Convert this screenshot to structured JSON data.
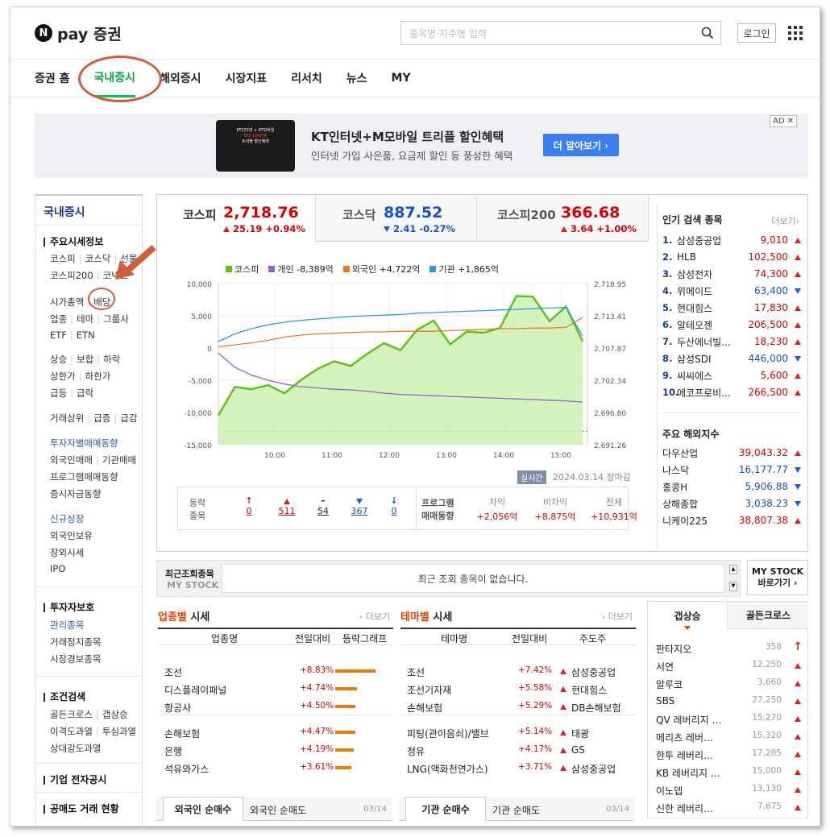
{
  "brand": {
    "logo_n": "N",
    "logo_text": "pay 증권"
  },
  "search": {
    "placeholder": "종목명·지수명 입력"
  },
  "header": {
    "login": "로그인"
  },
  "nav": [
    "증권 홈",
    "국내증시",
    "해외증시",
    "시장지표",
    "리서치",
    "뉴스",
    "MY"
  ],
  "ad": {
    "img_line1": "KT인터넷 + KT모바일",
    "img_line2": "최대 106만원",
    "img_line3": "트리플 할인혜택",
    "title": "KT인터넷+M모바일 트리플 할인혜택",
    "sub": "인터넷 가입 사은품, 요금제 할인 등 풍성한 혜택",
    "button": "더 알아보기 ›",
    "tag": "AD ✕"
  },
  "sidebar": {
    "title": "국내증시",
    "s1": "주요시세정보",
    "l1a": "코스피",
    "l1b": "코스닥",
    "l1c": "선물",
    "l2a": "코스피200",
    "l2b": "코넥스",
    "l3a": "시가총액",
    "l3b": "배당",
    "l4a": "업종",
    "l4b": "테마",
    "l4c": "그룹사",
    "l5a": "ETF",
    "l5b": "ETN",
    "l6a": "상승",
    "l6b": "보합",
    "l6c": "하락",
    "l7a": "상한가",
    "l7b": "하한가",
    "l8a": "급등",
    "l8b": "급락",
    "l9a": "거래상위",
    "l9b": "급증",
    "l9c": "급감",
    "l10": "투자자별매매동향",
    "l11a": "외국인매매",
    "l11b": "기관매매",
    "l12": "프로그램매매동향",
    "l13": "증시자금동향",
    "l14": "신규상장",
    "l15": "외국인보유",
    "l16": "장외시세",
    "l17": "IPO",
    "s2": "투자자보호",
    "l18": "관리종목",
    "l19": "거래정지종목",
    "l20": "시장경보종목",
    "s3": "조건검색",
    "l21a": "골든크로스",
    "l21b": "갭상승",
    "l22a": "이격도과열",
    "l22b": "투심과열",
    "l23": "상대강도과열",
    "s4": "기업 전자공시",
    "s5": "공매도 거래 현황"
  },
  "index_tabs": [
    {
      "name": "코스피",
      "value": "2,718.76",
      "change": "25.19 +0.94%",
      "dir": "up"
    },
    {
      "name": "코스닥",
      "value": "887.52",
      "change": "2.41 -0.27%",
      "dir": "down"
    },
    {
      "name": "코스피200",
      "value": "366.68",
      "change": "3.64 +1.00%",
      "dir": "up"
    }
  ],
  "chart_data": {
    "type": "line",
    "legend": [
      "코스피",
      "개인 -8,389억",
      "외국인 +4,722억",
      "기관 +1,865억"
    ],
    "x_ticks": [
      "10:00",
      "11:00",
      "12:00",
      "13:00",
      "14:00",
      "15:00"
    ],
    "y_left_ticks": [
      "10,000",
      "5,000",
      "0",
      "-5,000",
      "-10,000",
      "-15,000"
    ],
    "y_right_ticks": [
      "2,718.95",
      "2,713.41",
      "2,707.87",
      "2,702.34",
      "2,696.80",
      "2,691.26"
    ],
    "ylim_left": [
      -15000,
      10000
    ],
    "ylim_right": [
      2691.26,
      2718.95
    ],
    "series": [
      {
        "name": "코스피",
        "color": "#5ac41a",
        "values": [
          2696.3,
          2701.2,
          2700.8,
          2701.5,
          2700.1,
          2702.4,
          2704.3,
          2705.6,
          2704.8,
          2706.9,
          2708.7,
          2707.5,
          2711.0,
          2712.6,
          2708.5,
          2710.7,
          2710.5,
          2711.3,
          2716.8,
          2716.7,
          2712.5,
          2715.0,
          2709.0
        ]
      },
      {
        "name": "개인",
        "color": "#9a5fd0",
        "values": [
          -800,
          -3000,
          -4200,
          -5000,
          -5600,
          -6000,
          -6200,
          -6400,
          -6500,
          -6700,
          -7000,
          -7200,
          -7300,
          -7400,
          -7500,
          -7600,
          -7700,
          -7800,
          -7900,
          -8000,
          -8100,
          -8200,
          -8389
        ]
      },
      {
        "name": "외국인",
        "color": "#f07a1a",
        "values": [
          200,
          500,
          800,
          1200,
          1700,
          2000,
          2200,
          2300,
          2400,
          2500,
          2500,
          2600,
          2600,
          2600,
          2700,
          2800,
          2900,
          3000,
          3000,
          3100,
          3100,
          3200,
          4722
        ]
      },
      {
        "name": "기관",
        "color": "#2b9be8",
        "values": [
          1000,
          2200,
          3000,
          3600,
          4000,
          4300,
          4500,
          4700,
          4900,
          5000,
          5100,
          5200,
          5400,
          5500,
          5600,
          5700,
          5800,
          5900,
          6000,
          6100,
          6200,
          6300,
          1865
        ]
      }
    ]
  },
  "realtime": {
    "badge": "실시간",
    "date": "2024.03.14",
    "status": "장마감"
  },
  "trade": {
    "l1": "등락",
    "l2": "종목",
    "v1": "0",
    "v2": "511",
    "v3": "54",
    "v4": "367",
    "v5": "0",
    "p1": "프로그램",
    "p2": "매매동향",
    "h1": "차익",
    "h2": "비차익",
    "h3": "전체",
    "n1": "+2,056억",
    "n2": "+8,875억",
    "n3": "+10,931억"
  },
  "popular": {
    "title": "인기 검색 종목",
    "more": "더보기›",
    "items": [
      {
        "rank": "1.",
        "name": "삼성중공업",
        "price": "9,010",
        "dir": "up"
      },
      {
        "rank": "2.",
        "name": "HLB",
        "price": "102,500",
        "dir": "up"
      },
      {
        "rank": "3.",
        "name": "삼성전자",
        "price": "74,300",
        "dir": "up"
      },
      {
        "rank": "4.",
        "name": "위메이드",
        "price": "63,400",
        "dir": "down"
      },
      {
        "rank": "5.",
        "name": "현대힘스",
        "price": "17,830",
        "dir": "up"
      },
      {
        "rank": "6.",
        "name": "알테오젠",
        "price": "206,500",
        "dir": "up"
      },
      {
        "rank": "7.",
        "name": "두산에너빌...",
        "price": "18,230",
        "dir": "up"
      },
      {
        "rank": "8.",
        "name": "삼성SDI",
        "price": "446,000",
        "dir": "down"
      },
      {
        "rank": "9.",
        "name": "씨씨에스",
        "price": "5,600",
        "dir": "up"
      },
      {
        "rank": "10.",
        "name": "에코프로비...",
        "price": "266,500",
        "dir": "up"
      }
    ]
  },
  "overseas": {
    "title": "주요 해외지수",
    "items": [
      {
        "name": "다우산업",
        "price": "39,043.32",
        "dir": "up"
      },
      {
        "name": "나스닥",
        "price": "16,177.77",
        "dir": "down"
      },
      {
        "name": "홍콩H",
        "price": "5,906.88",
        "dir": "down"
      },
      {
        "name": "상해종합",
        "price": "3,038.23",
        "dir": "down"
      },
      {
        "name": "니케이225",
        "price": "38,807.38",
        "dir": "up"
      }
    ]
  },
  "recent": {
    "l1": "최근조회종목",
    "l2": "MY STOCK",
    "msg": "최근 조회 종목이 없습니다.",
    "my1": "MY STOCK",
    "my2": "바로가기 ›"
  },
  "sector": {
    "hd1": "업종별",
    "hd2": " 시세",
    "more": "› 더보기",
    "c1": "업종명",
    "c2": "전일대비",
    "c3": "등락그래프",
    "rows": [
      {
        "name": "조선",
        "pct": "+8.83%",
        "bar": 50
      },
      {
        "name": "디스플레이패널",
        "pct": "+4.74%",
        "bar": 27
      },
      {
        "name": "항공사",
        "pct": "+4.50%",
        "bar": 25
      },
      {
        "name": "손해보험",
        "pct": "+4.47%",
        "bar": 25
      },
      {
        "name": "은행",
        "pct": "+4.19%",
        "bar": 23
      },
      {
        "name": "석유와가스",
        "pct": "+3.61%",
        "bar": 20
      }
    ]
  },
  "theme": {
    "hd1": "테마별",
    "hd2": " 시세",
    "more": "› 더보기",
    "c1": "테마명",
    "c2": "전일대비",
    "c3": "주도주",
    "rows": [
      {
        "name": "조선",
        "pct": "+7.42%",
        "lead": "삼성중공업"
      },
      {
        "name": "조선기자재",
        "pct": "+5.58%",
        "lead": "현대힘스"
      },
      {
        "name": "손해보험",
        "pct": "+5.29%",
        "lead": "DB손해보험"
      },
      {
        "name": "피팅(관이음쇠)/밸브",
        "pct": "+5.14%",
        "lead": "태광"
      },
      {
        "name": "정유",
        "pct": "+4.17%",
        "lead": "GS"
      },
      {
        "name": "LNG(액화천연가스)",
        "pct": "+3.71%",
        "lead": "삼성중공업"
      }
    ]
  },
  "bottom": {
    "f1": "외국인 순매수",
    "f2": "외국인 순매도",
    "fd": "03/14",
    "i1": "기관 순매수",
    "i2": "기관 순매도",
    "id": "03/14"
  },
  "gap": {
    "t1": "갭상승",
    "t2": "골든크로스",
    "rows": [
      {
        "name": "판타지오",
        "val": "358",
        "big": true
      },
      {
        "name": "서연",
        "val": "12,250"
      },
      {
        "name": "알루코",
        "val": "3,660"
      },
      {
        "name": "SBS",
        "val": "27,250"
      },
      {
        "name": "QV 레버리지 …",
        "val": "15,270"
      },
      {
        "name": "메리츠 레버…",
        "val": "15,320"
      },
      {
        "name": "한투 레버리…",
        "val": "17,285"
      },
      {
        "name": "KB 레버리지 …",
        "val": "15,000"
      },
      {
        "name": "이노뎁",
        "val": "13,130"
      },
      {
        "name": "신한 레버리…",
        "val": "7,675"
      }
    ]
  }
}
